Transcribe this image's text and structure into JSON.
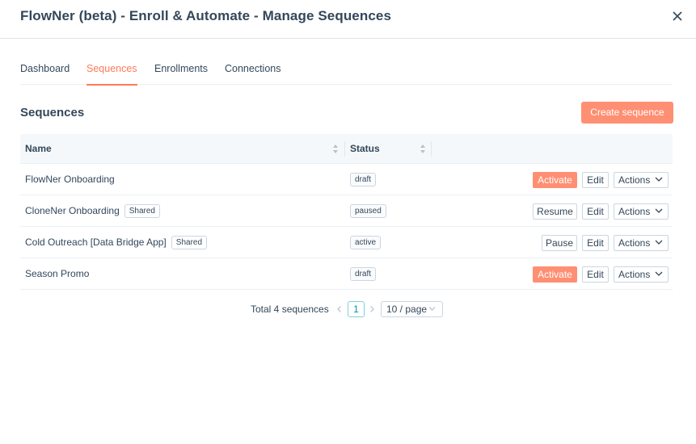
{
  "header": {
    "title": "FlowNer (beta) - Enroll & Automate - Manage Sequences",
    "close_icon": "close-icon"
  },
  "tabs": [
    {
      "label": "Dashboard",
      "active": false
    },
    {
      "label": "Sequences",
      "active": true
    },
    {
      "label": "Enrollments",
      "active": false
    },
    {
      "label": "Connections",
      "active": false
    }
  ],
  "section": {
    "title": "Sequences",
    "create_label": "Create sequence"
  },
  "table": {
    "columns": [
      "Name",
      "Status"
    ],
    "rows": [
      {
        "name": "FlowNer Onboarding",
        "shared": "",
        "status": "draft",
        "primary_action": "Activate",
        "edit": "Edit",
        "actions": "Actions"
      },
      {
        "name": "CloneNer Onboarding",
        "shared": "Shared",
        "status": "paused",
        "primary_action": "Resume",
        "edit": "Edit",
        "actions": "Actions"
      },
      {
        "name": "Cold Outreach [Data Bridge App]",
        "shared": "Shared",
        "status": "active",
        "primary_action": "Pause",
        "edit": "Edit",
        "actions": "Actions"
      },
      {
        "name": "Season Promo",
        "shared": "",
        "status": "draft",
        "primary_action": "Activate",
        "edit": "Edit",
        "actions": "Actions"
      }
    ]
  },
  "pagination": {
    "total": "Total 4 sequences",
    "current_page": "1",
    "page_size": "10 / page"
  },
  "colors": {
    "accent": "#ff7a59",
    "button_primary": "#ff8f73",
    "text": "#33475b",
    "border": "#cbd6e2",
    "page_active": "#0091ae"
  }
}
